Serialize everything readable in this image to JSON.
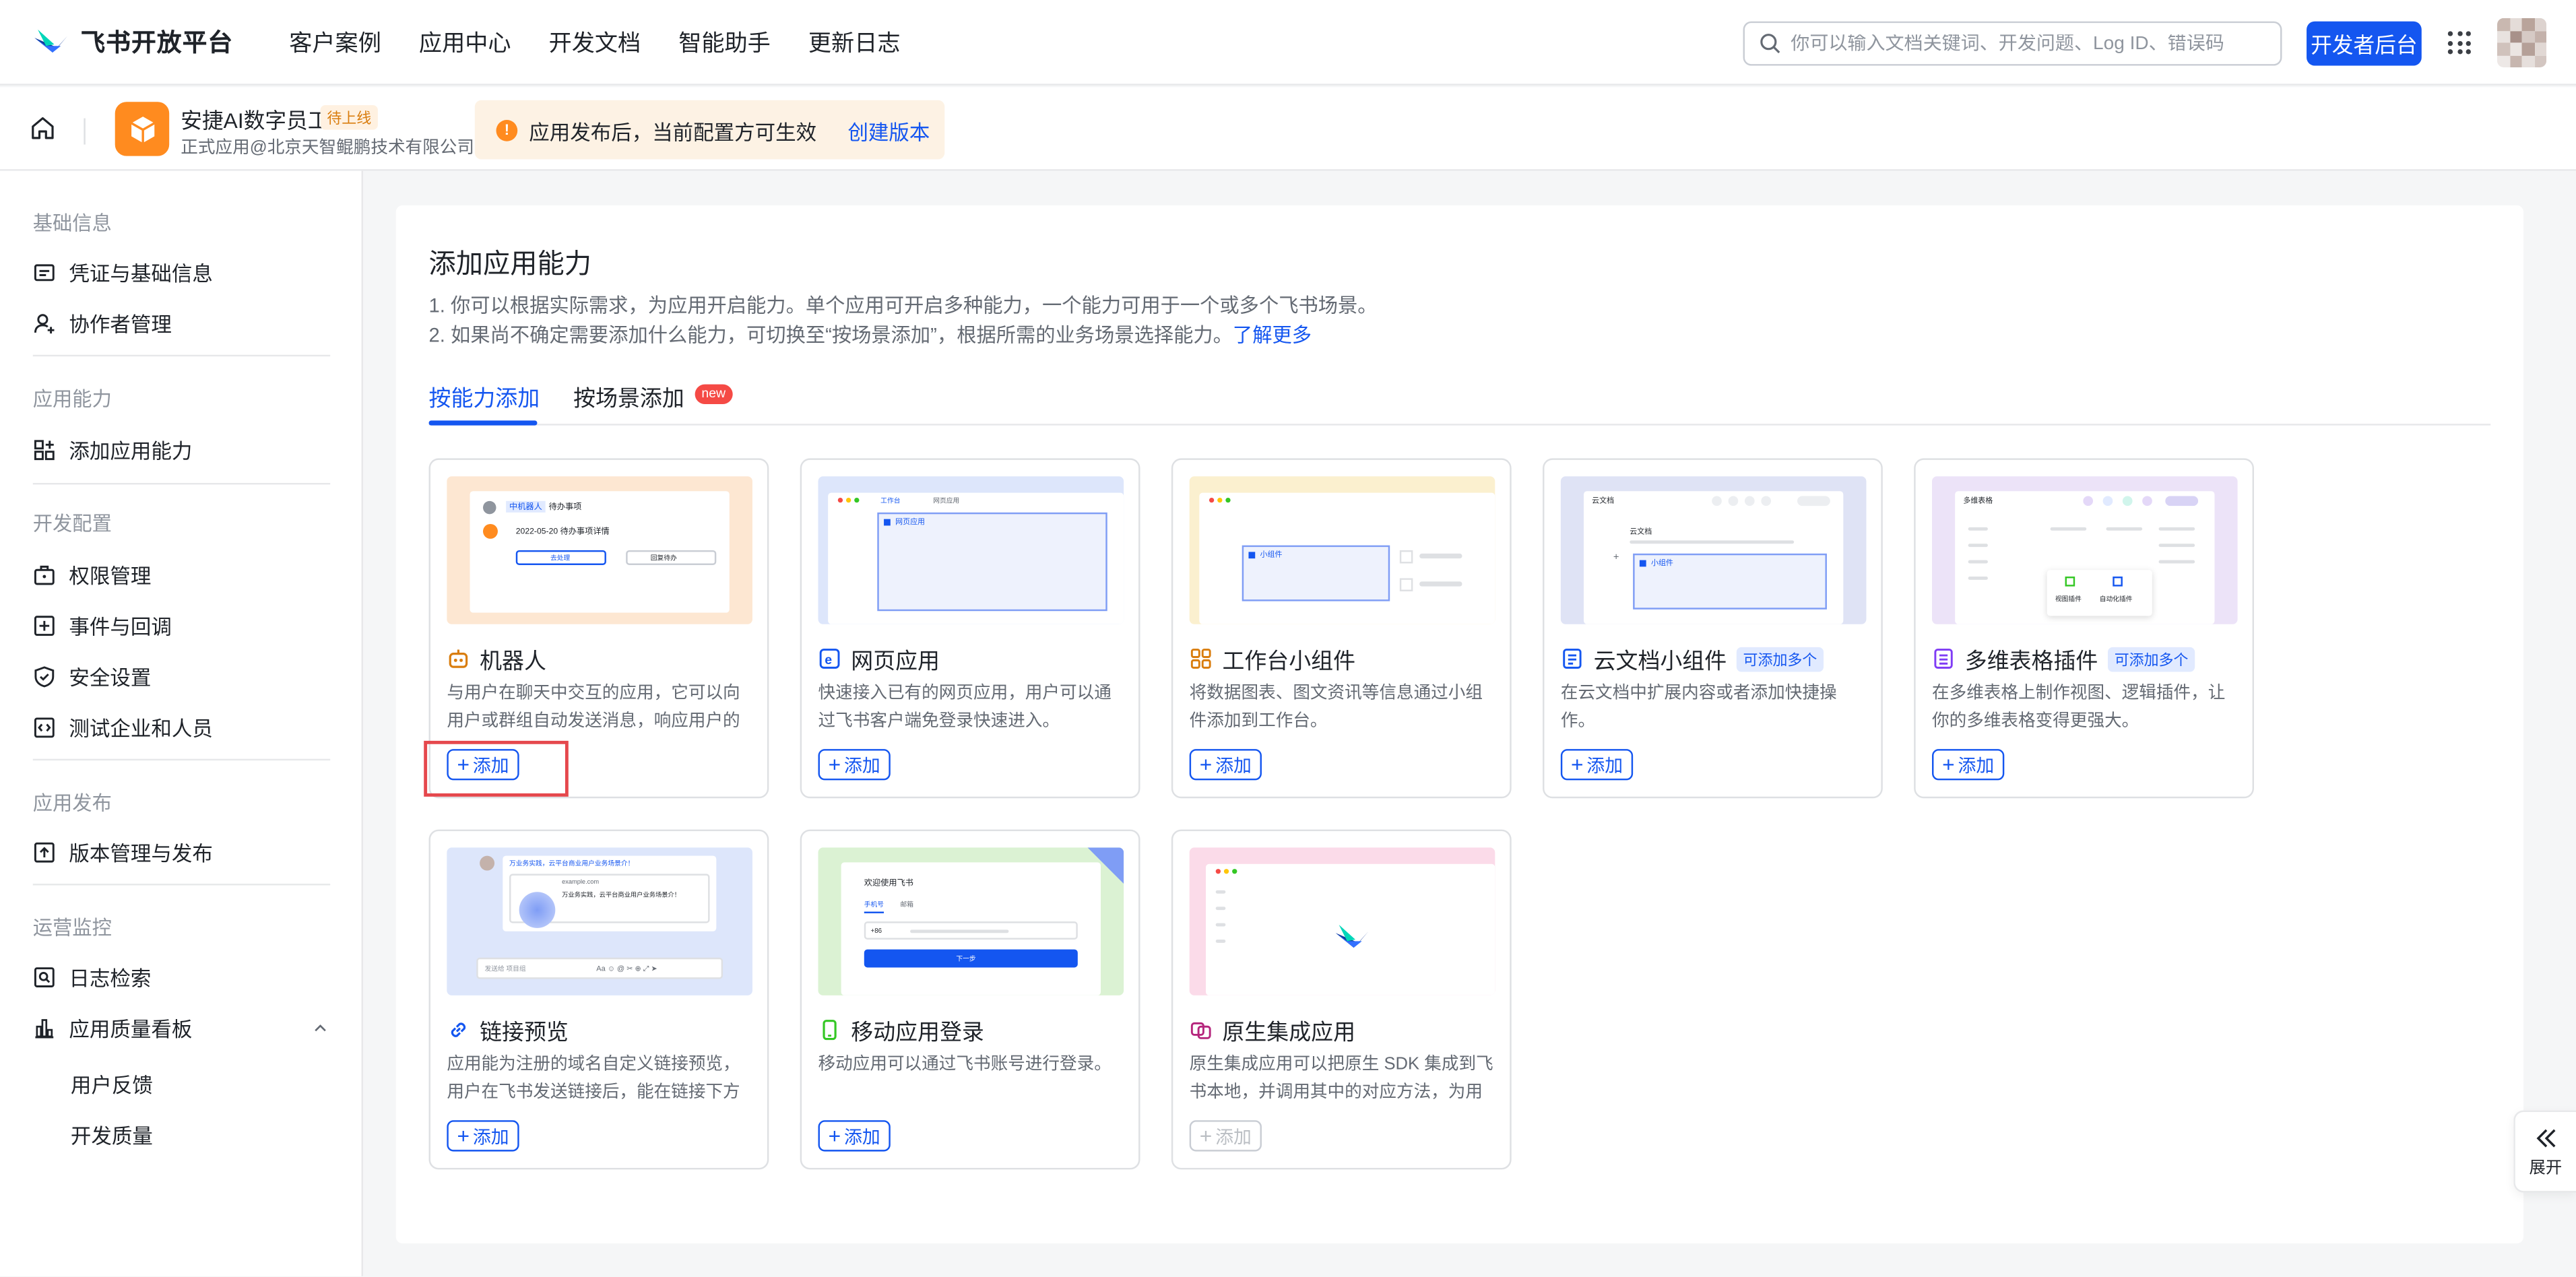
{
  "topnav": {
    "logo_text": "飞书开放平台",
    "links": [
      "客户案例",
      "应用中心",
      "开发文档",
      "智能助手",
      "更新日志"
    ],
    "search_placeholder": "你可以输入文档关键词、开发问题、Log ID、错误码",
    "dev_button": "开发者后台"
  },
  "app": {
    "name": "安捷AI数字员工",
    "status": "待上线",
    "subtitle": "正式应用@北京天智鲲鹏技术有限公司"
  },
  "notice": {
    "text": "应用发布后，当前配置方可生效",
    "link": "创建版本"
  },
  "sidebar": {
    "groups": [
      {
        "title": "基础信息",
        "items": [
          "凭证与基础信息",
          "协作者管理"
        ]
      },
      {
        "title": "应用能力",
        "items": [
          "添加应用能力"
        ]
      },
      {
        "title": "开发配置",
        "items": [
          "权限管理",
          "事件与回调",
          "安全设置",
          "测试企业和人员"
        ]
      },
      {
        "title": "应用发布",
        "items": [
          "版本管理与发布"
        ]
      },
      {
        "title": "运营监控",
        "items": [
          "日志检索",
          "应用质量看板"
        ],
        "subitems": [
          "用户反馈",
          "开发质量"
        ]
      }
    ]
  },
  "main": {
    "title": "添加应用能力",
    "desc1": "1. 你可以根据实际需求，为应用开启能力。单个应用可开启多种能力，一个能力可用于一个或多个飞书场景。",
    "desc2": "2. 如果尚不确定需要添加什么能力，可切换至“按场景添加”，根据所需的业务场景选择能力。",
    "desc2_link": "了解更多",
    "tabs": [
      "按能力添加",
      "按场景添加"
    ],
    "new_badge": "new",
    "add_label": "添加",
    "cards": [
      {
        "title": "机器人",
        "desc": "与用户在聊天中交互的应用，它可以向用户或群组自动发送消息，响应用户的消..."
      },
      {
        "title": "网页应用",
        "desc": "快速接入已有的网页应用，用户可以通过飞书客户端免登录快速进入。"
      },
      {
        "title": "工作台小组件",
        "desc": "将数据图表、图文资讯等信息通过小组件添加到工作台。"
      },
      {
        "title": "云文档小组件",
        "badge": "可添加多个",
        "desc": "在云文档中扩展内容或者添加快捷操作。"
      },
      {
        "title": "多维表格插件",
        "badge": "可添加多个",
        "desc": "在多维表格上制作视图、逻辑插件，让你的多维表格变得更强大。"
      },
      {
        "title": "链接预览",
        "desc": "应用能为注册的域名自定义链接预览，用户在飞书发送链接后，能在链接下方展示..."
      },
      {
        "title": "移动应用登录",
        "desc": "移动应用可以通过飞书账号进行登录。"
      },
      {
        "title": "原生集成应用",
        "desc": "原生集成应用可以把原生 SDK 集成到飞书本地，并调用其中的对应方法，为用户提..."
      }
    ]
  },
  "thumbs": {
    "robot_chip": "中机器人",
    "robot_chip2": "待办事项",
    "robot_line": "2022-05-20 待办事项详情",
    "robot_btn1": "去处理",
    "robot_btn2": "回复待办",
    "web_tab1": "工作台",
    "web_tab2": "网页应用",
    "web_label": "网页应用",
    "widget_label": "小组件",
    "doc_title": "云文档",
    "doc_line": "云文档",
    "doc_label": "小组件",
    "base_title": "多维表格",
    "base_pop1": "视图插件",
    "base_pop2": "自动化插件",
    "link_bar": "万业务实践，云平台商业用户业务场景介！",
    "link_url": "example.com",
    "link_sub": "万业务实践，云平台商业用户业务场景介！",
    "link_input": "发送给 项目组",
    "mobile_title": "欢迎使用飞书",
    "mobile_tab1": "手机号",
    "mobile_tab2": "邮箱",
    "mobile_code": "+86",
    "mobile_btn": "下一步"
  },
  "expand_label": "展开",
  "colors": {
    "accent": "#1456f0",
    "warning": "#ff8b1f",
    "danger": "#f54a45",
    "highlight": "#e5484d"
  }
}
